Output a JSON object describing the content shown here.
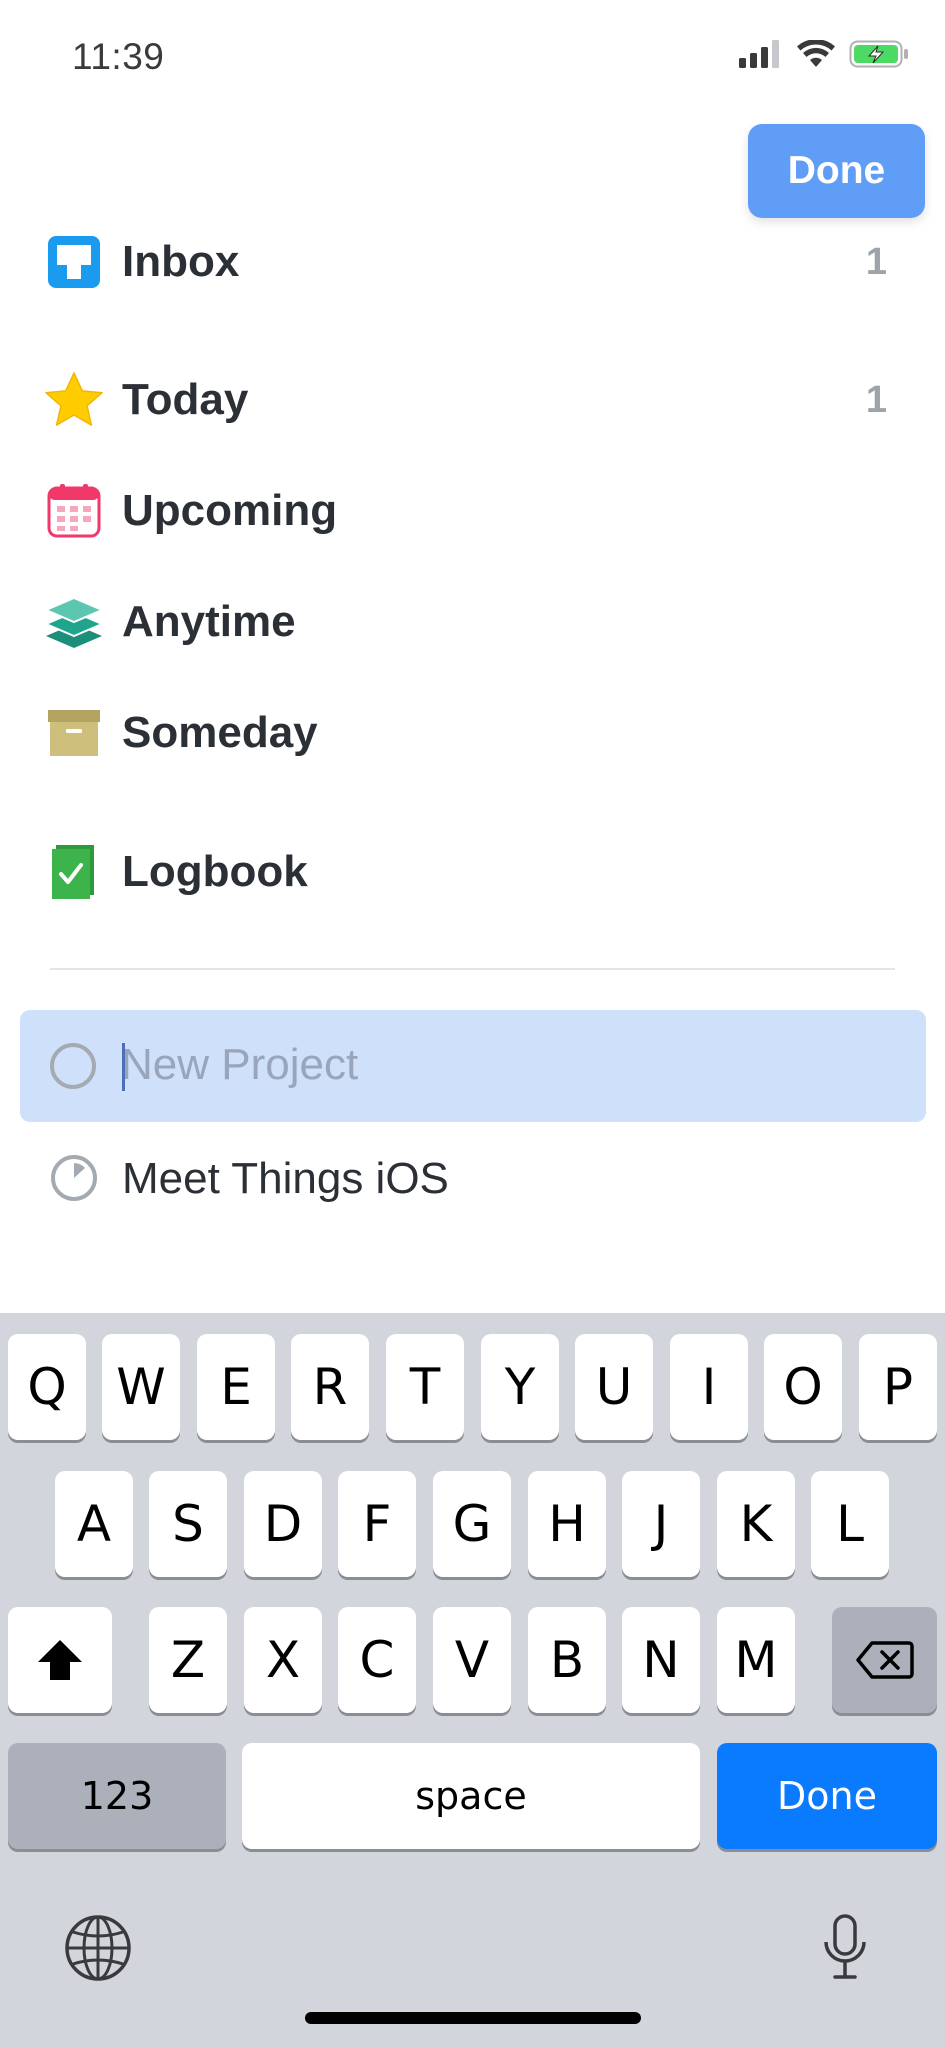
{
  "status_bar": {
    "time": "11:39"
  },
  "header": {
    "done_label": "Done"
  },
  "lists": [
    {
      "label": "Inbox",
      "count": "1",
      "icon": "inbox-icon",
      "color": "#1a9bf0"
    },
    {
      "label": "Today",
      "count": "1",
      "icon": "star-icon",
      "color": "#ffcc00"
    },
    {
      "label": "Upcoming",
      "count": "",
      "icon": "calendar-icon",
      "color": "#f0386b"
    },
    {
      "label": "Anytime",
      "count": "",
      "icon": "layers-icon",
      "color": "#1fa58d"
    },
    {
      "label": "Someday",
      "count": "",
      "icon": "archive-box-icon",
      "color": "#c8b878"
    },
    {
      "label": "Logbook",
      "count": "",
      "icon": "logbook-icon",
      "color": "#3cb34b"
    }
  ],
  "new_project": {
    "placeholder": "New Project"
  },
  "projects": [
    {
      "label": "Meet Things iOS",
      "icon": "progress-pie-icon"
    }
  ],
  "keyboard": {
    "row1": [
      "Q",
      "W",
      "E",
      "R",
      "T",
      "Y",
      "U",
      "I",
      "O",
      "P"
    ],
    "row2": [
      "A",
      "S",
      "D",
      "F",
      "G",
      "H",
      "J",
      "K",
      "L"
    ],
    "row3": [
      "Z",
      "X",
      "C",
      "V",
      "B",
      "N",
      "M"
    ],
    "numbers_label": "123",
    "space_label": "space",
    "done_label": "Done"
  },
  "colors": {
    "accent": "#0a7aff",
    "selection": "#cfe0fb",
    "header_done": "#5f9df7"
  }
}
